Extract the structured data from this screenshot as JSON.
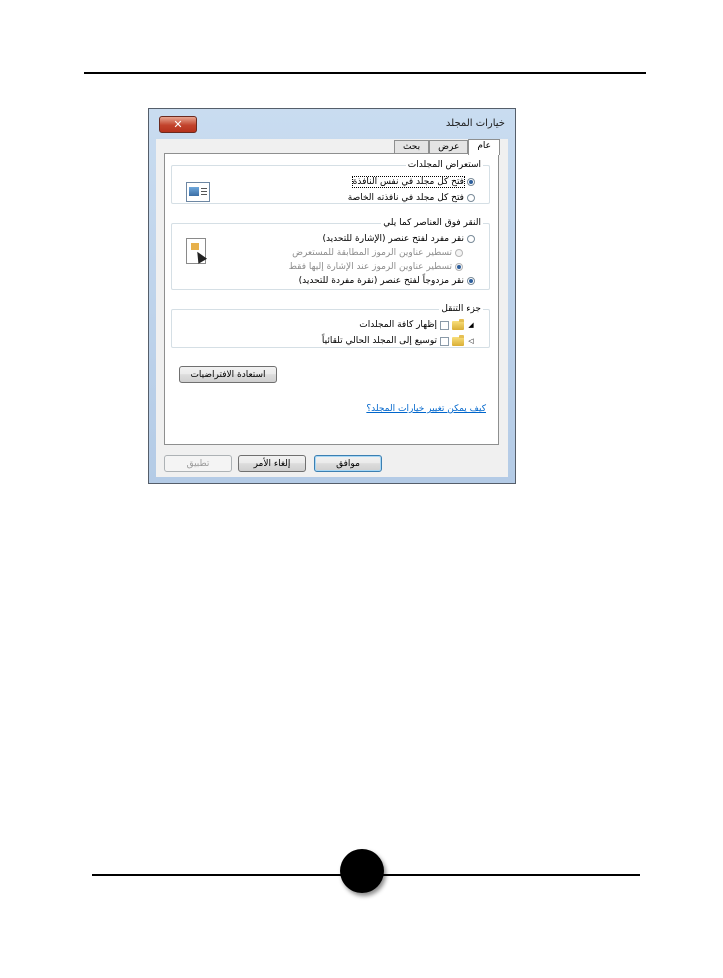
{
  "dialog": {
    "title": "خيارات المجلد",
    "close_label": "✕"
  },
  "tabs": [
    {
      "label": "عام",
      "active": true
    },
    {
      "label": "عرض",
      "active": false
    },
    {
      "label": "بحث",
      "active": false
    }
  ],
  "browse_folders": {
    "legend": "استعراض المجلدات",
    "options": [
      {
        "label": "فتح كل مجلد في نفس النافذة",
        "selected": true
      },
      {
        "label": "فتح كل مجلد في نافذته الخاصة",
        "selected": false
      }
    ]
  },
  "click_items": {
    "legend": "النقر فوق العناصر كما يلي",
    "options": [
      {
        "label": "نقر مفرد لفتح عنصر (الإشارة للتحديد)",
        "selected": false,
        "enabled": true
      },
      {
        "label": "تسطير عناوين الرموز المطابقة للمستعرض",
        "selected": false,
        "enabled": false
      },
      {
        "label": "تسطير عناوين الرموز عند الإشارة إليها فقط",
        "selected": true,
        "enabled": false
      },
      {
        "label": "نقر مزدوجاً لفتح عنصر (نقرة مفردة للتحديد)",
        "selected": true,
        "enabled": true
      }
    ]
  },
  "navigation_pane": {
    "legend": "جزء التنقل",
    "options": [
      {
        "label": "إظهار كافة المجلدات",
        "checked": false
      },
      {
        "label": "توسيع إلى المجلد الحالي تلقائياً",
        "checked": false
      }
    ]
  },
  "restore_defaults_label": "استعادة الافتراضيات",
  "help_link": "كيف يمكن تغيير خيارات المجلد؟",
  "buttons": {
    "ok": "موافق",
    "cancel": "إلغاء الأمر",
    "apply": "تطبيق"
  },
  "colors": {
    "title_bar": "#c9dcf0",
    "close_button": "#c2432c",
    "link": "#0066cc"
  }
}
